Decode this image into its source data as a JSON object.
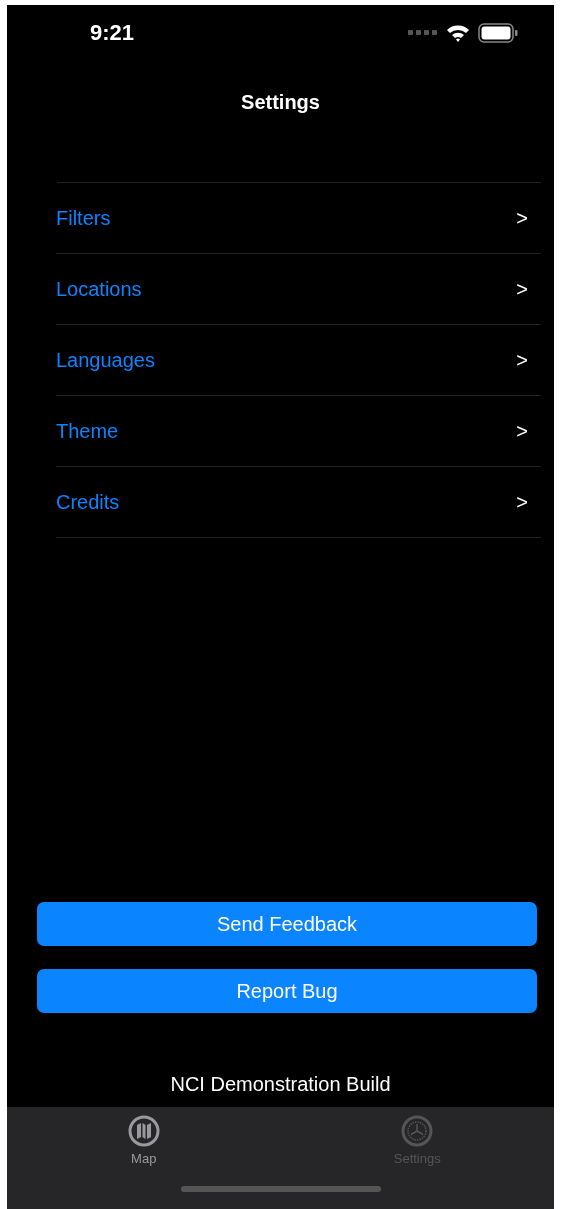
{
  "status_bar": {
    "time": "9:21"
  },
  "nav": {
    "title": "Settings"
  },
  "items": [
    {
      "label": "Filters",
      "chevron": ">"
    },
    {
      "label": "Locations",
      "chevron": ">"
    },
    {
      "label": "Languages",
      "chevron": ">"
    },
    {
      "label": "Theme",
      "chevron": ">"
    },
    {
      "label": "Credits",
      "chevron": ">"
    }
  ],
  "buttons": [
    "Send Feedback",
    "Report Bug"
  ],
  "footer": "NCI Demonstration Build",
  "tabs": [
    {
      "label": "Map",
      "kind": "map",
      "selected": true
    },
    {
      "label": "Settings",
      "kind": "settings",
      "selected": false
    }
  ]
}
